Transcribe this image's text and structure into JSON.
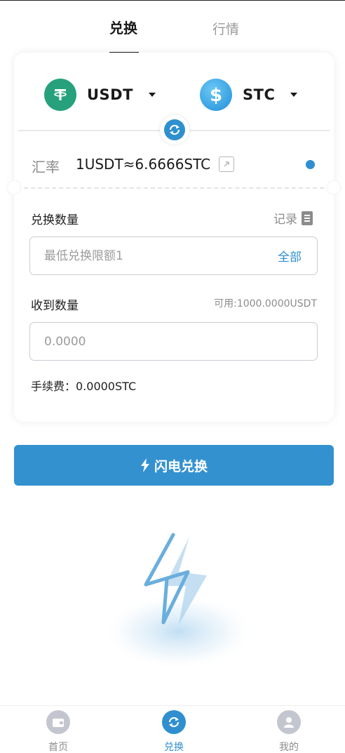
{
  "tabs": [
    {
      "label": "兑换",
      "active": true
    },
    {
      "label": "行情",
      "active": false
    }
  ],
  "exchange": {
    "from_coin": "USDT",
    "to_coin": "STC",
    "rate_label": "汇率",
    "rate_value": "1USDT≈6.6666STC",
    "amount_label": "兑换数量",
    "records_label": "记录",
    "amount_placeholder": "最低兑换限额1",
    "all_label": "全部",
    "receive_label": "收到数量",
    "available": "可用:1000.0000USDT",
    "receive_placeholder": "0.0000",
    "fee": "手续费：0.0000STC"
  },
  "flash_button": {
    "label": "闪电兑换"
  },
  "bottom_nav": [
    {
      "label": "首页",
      "active": false
    },
    {
      "label": "兑换",
      "active": true
    },
    {
      "label": "我的",
      "active": false
    }
  ],
  "colors": {
    "accent": "#3491cf",
    "usdt_green": "#26a17b",
    "muted": "#8c8c8c"
  },
  "icons": {
    "usdt": "tether-icon",
    "stc": "dollar-coin-icon",
    "swap": "swap-arrows-icon",
    "external": "external-link-icon",
    "records": "document-icon",
    "flash": "lightning-icon",
    "home": "wallet-icon",
    "me": "user-icon"
  }
}
